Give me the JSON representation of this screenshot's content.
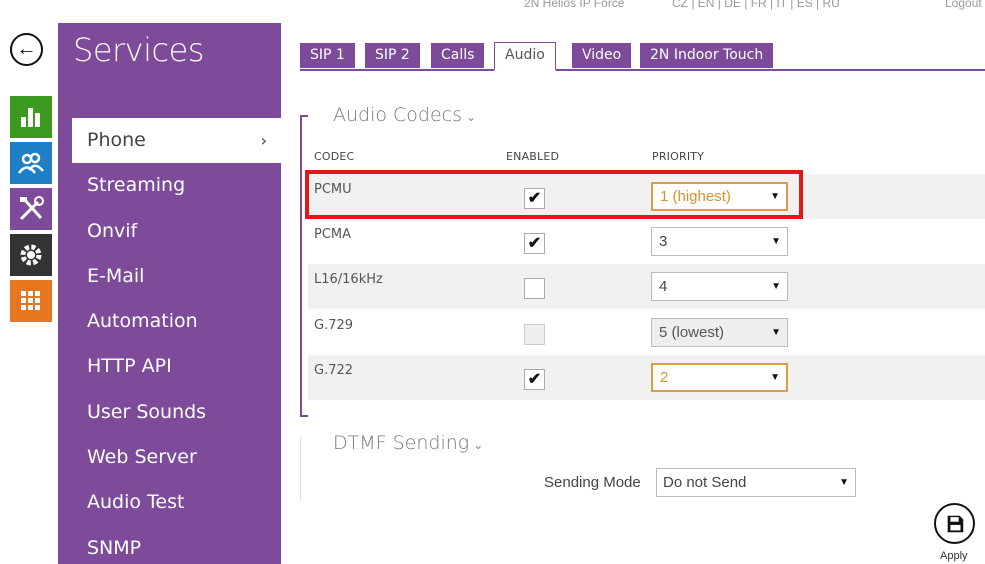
{
  "topbar": {
    "device": "2N Helios IP Force",
    "languages": "CZ | EN | DE | FR | IT | ES | RU",
    "logout": "Logout"
  },
  "rail": {
    "icons": [
      {
        "name": "status-icon",
        "color": "#3c9b1f"
      },
      {
        "name": "users-icon",
        "color": "#1f7fc6"
      },
      {
        "name": "tools-icon",
        "color": "#7d4b99"
      },
      {
        "name": "gear-icon",
        "color": "#333333"
      },
      {
        "name": "grid-icon",
        "color": "#e8761f"
      }
    ]
  },
  "sidebar": {
    "title": "Services",
    "items": [
      {
        "label": "Phone",
        "active": true
      },
      {
        "label": "Streaming"
      },
      {
        "label": "Onvif"
      },
      {
        "label": "E-Mail"
      },
      {
        "label": "Automation"
      },
      {
        "label": "HTTP API"
      },
      {
        "label": "User Sounds"
      },
      {
        "label": "Web Server"
      },
      {
        "label": "Audio Test"
      },
      {
        "label": "SNMP"
      }
    ]
  },
  "tabs": [
    "SIP 1",
    "SIP 2",
    "Calls",
    "Audio",
    "Video",
    "2N Indoor Touch"
  ],
  "audio_codecs": {
    "title": "Audio Codecs",
    "columns": {
      "codec": "CODEC",
      "enabled": "ENABLED",
      "priority": "PRIORITY"
    },
    "rows": [
      {
        "codec": "PCMU",
        "enabled": true,
        "priority": "1 (highest)",
        "state": "changed"
      },
      {
        "codec": "PCMA",
        "enabled": true,
        "priority": "3",
        "state": "normal"
      },
      {
        "codec": "L16/16kHz",
        "enabled": false,
        "priority": "4",
        "state": "normal"
      },
      {
        "codec": "G.729",
        "enabled": false,
        "priority": "5 (lowest)",
        "state": "disabled"
      },
      {
        "codec": "G.722",
        "enabled": true,
        "priority": "2",
        "state": "changed"
      }
    ]
  },
  "dtmf": {
    "title": "DTMF Sending",
    "sending_mode_label": "Sending Mode",
    "sending_mode_value": "Do not Send"
  },
  "apply": {
    "label": "Apply"
  },
  "colors": {
    "accent": "#7d4b99",
    "highlight": "#e0181a",
    "changed": "#d8922e"
  }
}
